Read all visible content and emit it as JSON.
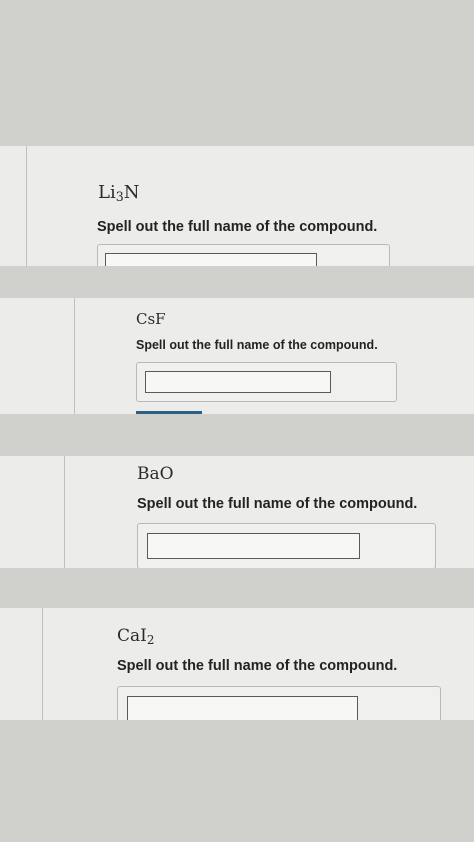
{
  "questions": [
    {
      "formula": {
        "base": "Li",
        "sub": "3",
        "rest": "N"
      },
      "prompt": "Spell out the full name of the compound.",
      "answer_value": ""
    },
    {
      "formula": {
        "base": "CsF",
        "sub": "",
        "rest": ""
      },
      "prompt": "Spell out the full name of the compound.",
      "answer_value": ""
    },
    {
      "formula": {
        "base": "BaO",
        "sub": "",
        "rest": ""
      },
      "prompt": "Spell out the full name of the compound.",
      "answer_value": ""
    },
    {
      "formula": {
        "base": "CaI",
        "sub": "2",
        "rest": ""
      },
      "prompt": "Spell out the full name of the compound.",
      "answer_value": ""
    }
  ],
  "colors": {
    "background": "#d0d1cc",
    "panel": "#ececea",
    "text": "#232323",
    "submit_accent": "#2b5f86"
  }
}
